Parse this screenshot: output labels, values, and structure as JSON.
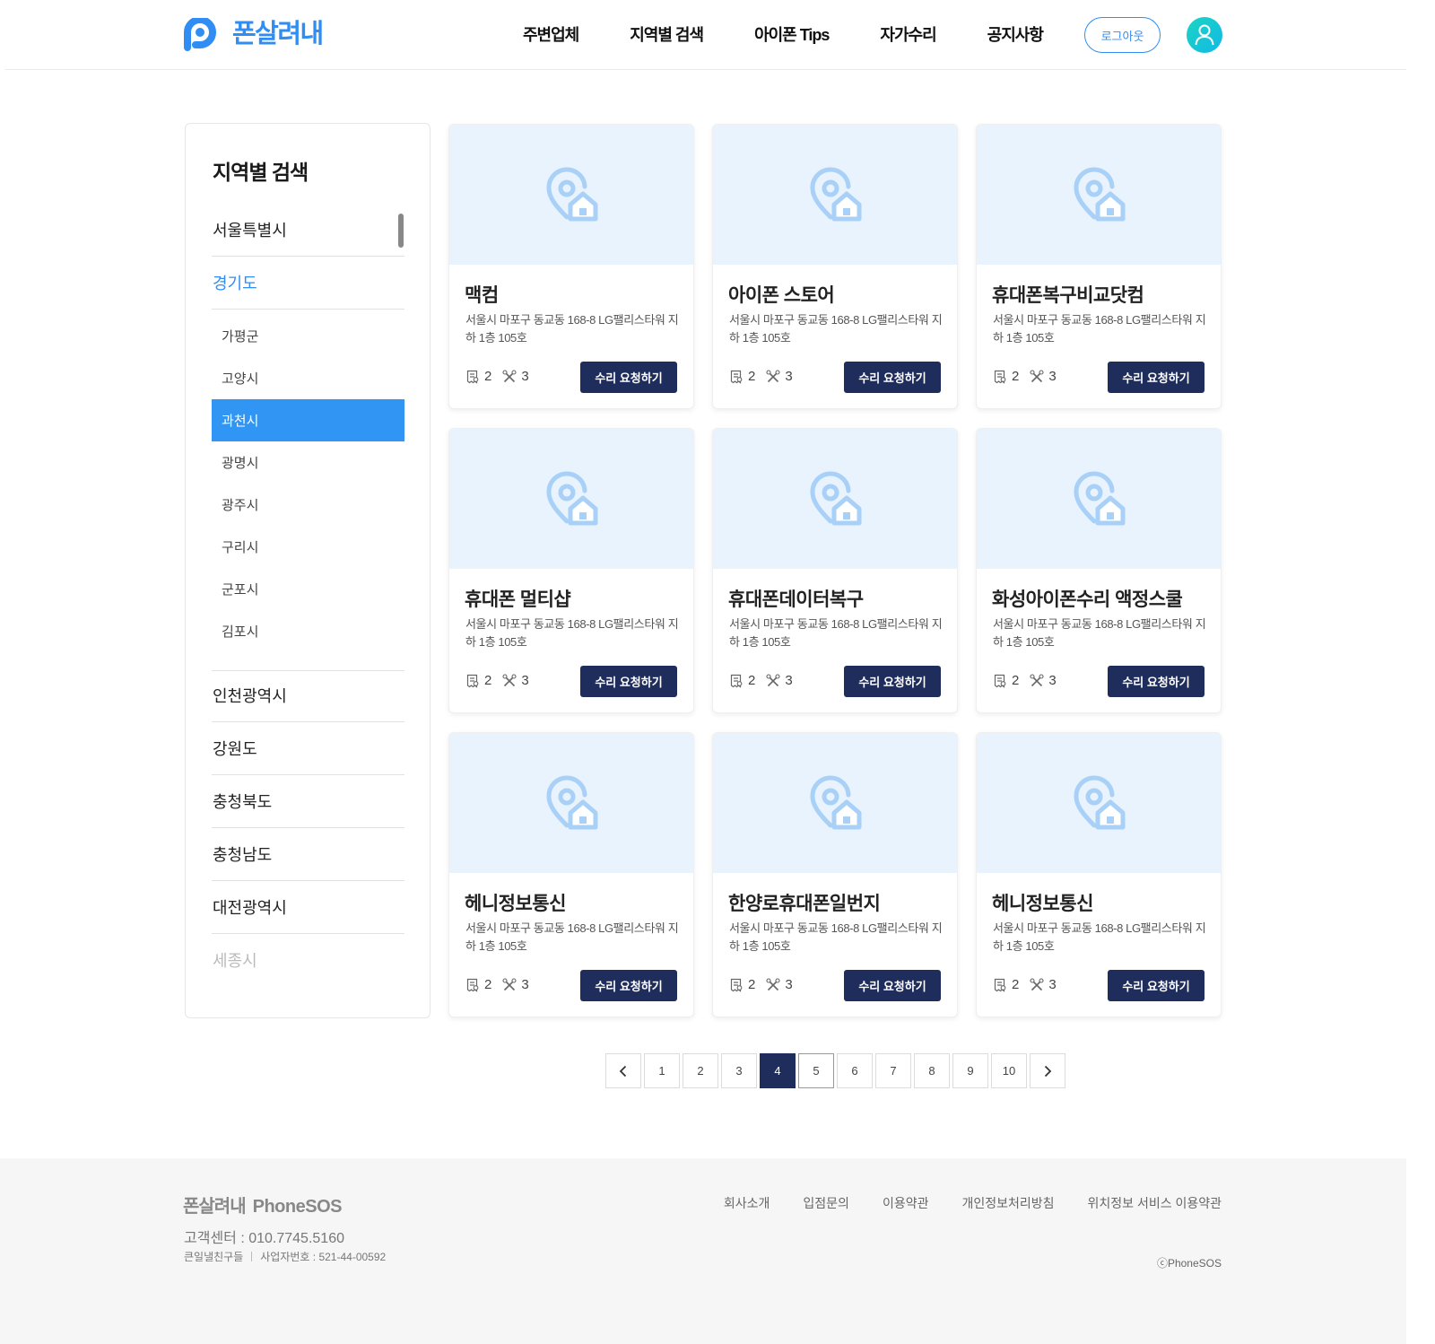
{
  "header": {
    "logo_text": "폰살려내",
    "nav": [
      "주변업체",
      "지역별 검색",
      "아이폰 Tips",
      "자가수리",
      "공지사항"
    ],
    "logout_label": "로그아웃"
  },
  "sidebar": {
    "title": "지역별 검색",
    "regions_top": [
      "서울특별시",
      "경기도"
    ],
    "sub_regions": [
      "가평군",
      "고양시",
      "과천시",
      "광명시",
      "광주시",
      "구리시",
      "군포시",
      "김포시"
    ],
    "selected_sub": "과천시",
    "regions_bottom": [
      "인천광역시",
      "강원도",
      "충청북도",
      "충청남도",
      "대전광역시",
      "세종시"
    ]
  },
  "cards": [
    {
      "title": "맥컴",
      "address": "서울시 마포구 동교동 168-8 LG팰리스타워 지하 1층 105호",
      "reviews": "2",
      "repairs": "3",
      "button": "수리 요청하기"
    },
    {
      "title": "아이폰 스토어",
      "address": "서울시 마포구 동교동 168-8 LG팰리스타워 지하 1층 105호",
      "reviews": "2",
      "repairs": "3",
      "button": "수리 요청하기"
    },
    {
      "title": "휴대폰복구비교닷컴",
      "address": "서울시 마포구 동교동 168-8 LG팰리스타워 지하 1층 105호",
      "reviews": "2",
      "repairs": "3",
      "button": "수리 요청하기"
    },
    {
      "title": "휴대폰 멀티샵",
      "address": "서울시 마포구 동교동 168-8 LG팰리스타워 지하 1층 105호",
      "reviews": "2",
      "repairs": "3",
      "button": "수리 요청하기"
    },
    {
      "title": "휴대폰데이터복구",
      "address": "서울시 마포구 동교동 168-8 LG팰리스타워 지하 1층 105호",
      "reviews": "2",
      "repairs": "3",
      "button": "수리 요청하기"
    },
    {
      "title": "화성아이폰수리 액정스쿨",
      "address": "서울시 마포구 동교동 168-8 LG팰리스타워 지하 1층 105호",
      "reviews": "2",
      "repairs": "3",
      "button": "수리 요청하기"
    },
    {
      "title": "헤니정보통신",
      "address": "서울시 마포구 동교동 168-8 LG팰리스타워 지하 1층 105호",
      "reviews": "2",
      "repairs": "3",
      "button": "수리 요청하기"
    },
    {
      "title": "한양로휴대폰일번지",
      "address": "서울시 마포구 동교동 168-8 LG팰리스타워 지하 1층 105호",
      "reviews": "2",
      "repairs": "3",
      "button": "수리 요청하기"
    },
    {
      "title": "헤니정보통신",
      "address": "서울시 마포구 동교동 168-8 LG팰리스타워 지하 1층 105호",
      "reviews": "2",
      "repairs": "3",
      "button": "수리 요청하기"
    }
  ],
  "pagination": {
    "pages": [
      "1",
      "2",
      "3",
      "4",
      "5",
      "6",
      "7",
      "8",
      "9",
      "10"
    ],
    "current": "4",
    "prev_icon": "chevron-left-icon",
    "next_icon": "chevron-right-icon"
  },
  "footer": {
    "logo_korean": "폰살려내",
    "logo_english": "PhoneSOS",
    "customer_center": "고객센터 : 010.7745.5160",
    "company": "큰일낼친구들",
    "business_number": "사업자번호 : 521-44-00592",
    "links": [
      "회사소개",
      "입점문의",
      "이용약관",
      "개인정보처리방침",
      "위치정보 서비스 이용약관"
    ],
    "copyright": "ⓒPhoneSOS"
  },
  "colors": {
    "brand_blue": "#2f8df3",
    "navy": "#1f2d5c",
    "card_image_bg": "#e8f3fd",
    "selected_bg": "#3196f3"
  },
  "icons": {
    "card_image": "location-pin-house-icon",
    "review": "receipt-icon",
    "repair": "tools-icon",
    "avatar": "user-icon"
  }
}
